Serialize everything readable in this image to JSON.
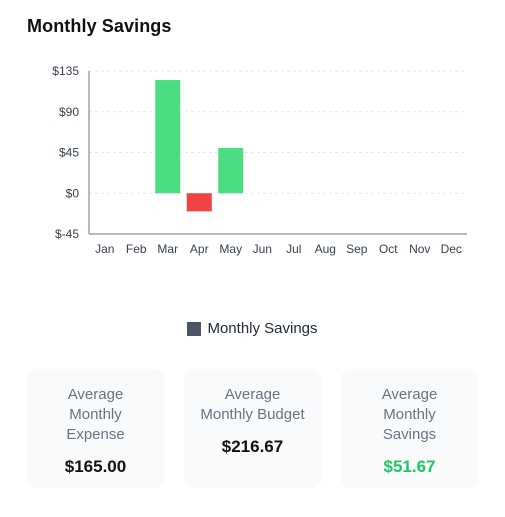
{
  "title": "Monthly Savings",
  "chart_data": {
    "type": "bar",
    "title": "Monthly Savings",
    "categories": [
      "Jan",
      "Feb",
      "Mar",
      "Apr",
      "May",
      "Jun",
      "Jul",
      "Aug",
      "Sep",
      "Oct",
      "Nov",
      "Dec"
    ],
    "series": [
      {
        "name": "Monthly Savings",
        "values": [
          0,
          0,
          125,
          -20,
          50,
          0,
          0,
          0,
          0,
          0,
          0,
          0
        ]
      }
    ],
    "y_ticks": [
      135,
      90,
      45,
      0,
      -45
    ],
    "y_tick_labels": [
      "$135",
      "$90",
      "$45",
      "$0",
      "$-45"
    ],
    "ylim": [
      -45,
      135
    ],
    "grid": true,
    "legend_position": "bottom",
    "colors": {
      "positive": "#4ade80",
      "negative": "#ef4444",
      "legend": "#4b5563"
    }
  },
  "legend": {
    "label": "Monthly Savings"
  },
  "cards": [
    {
      "label": "Average\nMonthly\nExpense",
      "value": "$165.00",
      "tone": "default"
    },
    {
      "label": "Average\nMonthly Budget",
      "value": "$216.67",
      "tone": "default"
    },
    {
      "label": "Average\nMonthly\nSavings",
      "value": "$51.67",
      "tone": "positive"
    }
  ]
}
